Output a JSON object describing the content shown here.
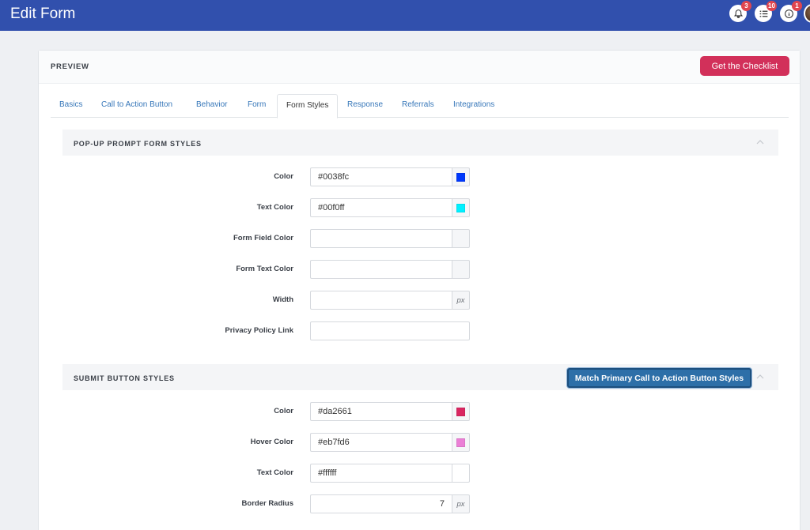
{
  "header": {
    "title": "Edit Form",
    "notifications_badge": "3",
    "tasks_badge": "10",
    "info_badge": "1"
  },
  "card": {
    "label": "PREVIEW",
    "checklist_button": "Get the Checklist"
  },
  "tabs": [
    {
      "label": "Basics"
    },
    {
      "label": "Call to Action Button"
    },
    {
      "label": "Behavior"
    },
    {
      "label": "Form"
    },
    {
      "label": "Form Styles"
    },
    {
      "label": "Response"
    },
    {
      "label": "Referrals"
    },
    {
      "label": "Integrations"
    }
  ],
  "popup_section": {
    "title": "POP-UP PROMPT FORM STYLES",
    "fields": [
      {
        "label": "Color",
        "value": "#0038fc",
        "swatch": "#0038fc"
      },
      {
        "label": "Text Color",
        "value": "#00f0ff",
        "swatch": "#00f0ff"
      },
      {
        "label": "Form Field Color",
        "value": "",
        "swatch": "#f5f6f8"
      },
      {
        "label": "Form Text Color",
        "value": "",
        "swatch": "#f5f6f8"
      },
      {
        "label": "Width",
        "value": "",
        "unit": "px"
      },
      {
        "label": "Privacy Policy Link",
        "value": ""
      }
    ]
  },
  "submit_section": {
    "title": "SUBMIT BUTTON STYLES",
    "match_button": "Match Primary Call to Action Button Styles",
    "fields": [
      {
        "label": "Color",
        "value": "#da2661",
        "swatch": "#da2661"
      },
      {
        "label": "Hover Color",
        "value": "#eb7fd6",
        "swatch": "#eb7fd6"
      },
      {
        "label": "Text Color",
        "value": "#ffffff",
        "swatch": "#ffffff"
      },
      {
        "label": "Border Radius",
        "value": "7",
        "unit": "px"
      }
    ]
  },
  "colors": {
    "topbar": "#3150ad",
    "primary_button": "#d2305a",
    "match_button": "#2d6fa8",
    "link": "#3777b9"
  }
}
